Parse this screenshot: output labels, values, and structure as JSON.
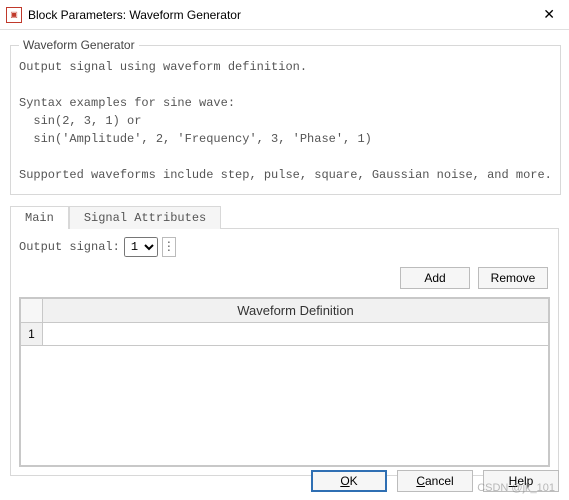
{
  "window": {
    "title": "Block Parameters: Waveform Generator",
    "close_glyph": "✕"
  },
  "group": {
    "legend": "Waveform Generator",
    "line1": "Output signal using waveform definition.",
    "line2": "Syntax examples for sine wave:",
    "line3": "  sin(2, 3, 1) or",
    "line4": "  sin('Amplitude', 2, 'Frequency', 3, 'Phase', 1)",
    "line5": "Supported waveforms include step, pulse, square, Gaussian noise, and more."
  },
  "tabs": {
    "main": "Main",
    "signal_attributes": "Signal Attributes"
  },
  "output_signal": {
    "label": "Output signal:",
    "value": "1",
    "actions_glyph": "⋮"
  },
  "buttons": {
    "add": "Add",
    "remove": "Remove",
    "ok": "OK",
    "cancel": "Cancel",
    "help": "Help"
  },
  "table": {
    "header": "Waveform Definition",
    "rows": [
      {
        "num": "1",
        "value": ""
      }
    ]
  },
  "watermark": "CSDN @jk_101"
}
